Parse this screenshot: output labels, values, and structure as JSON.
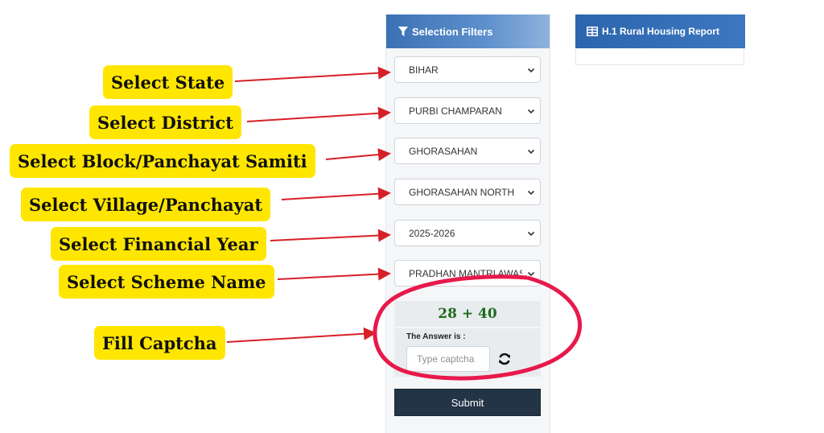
{
  "filters": {
    "header_title": "Selection Filters",
    "state": "BIHAR",
    "district": "PURBI CHAMPARAN",
    "block": "GHORASAHAN",
    "village": "GHORASAHAN NORTH",
    "financial_year": "2025-2026",
    "scheme": "PRADHAN MANTRI AWAS YOJANA"
  },
  "captcha": {
    "question": "28 + 40",
    "answer_label": "The Answer is :",
    "placeholder": "Type captcha"
  },
  "submit_label": "Submit",
  "report": {
    "title": "H.1 Rural Housing Report"
  },
  "callouts": {
    "state": "Select State",
    "district": "Select District",
    "block": "Select Block/Panchayat Samiti",
    "village": "Select Village/Panchayat",
    "financial_year": "Select Financial Year",
    "scheme": "Select Scheme Name",
    "captcha": "Fill Captcha"
  },
  "colors": {
    "callout_bg": "#ffe600",
    "arrow": "#d62027",
    "highlight_circle": "#e8194b",
    "header_blue": "#3b71b5",
    "submit_bg": "#243447"
  }
}
